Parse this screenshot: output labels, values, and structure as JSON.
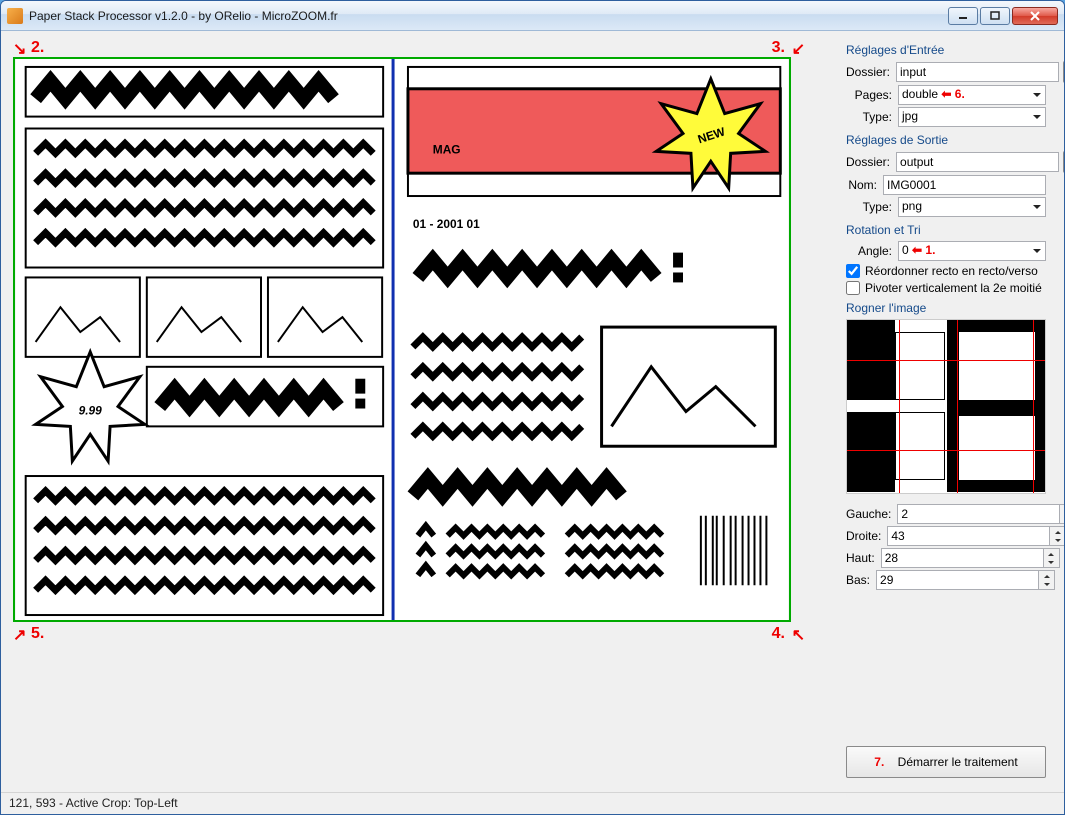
{
  "window": {
    "title": "Paper Stack Processor v1.2.0 - by ORelio - MicroZOOM.fr"
  },
  "annotations": {
    "n2": "2.",
    "n3": "3.",
    "n4": "4.",
    "n5": "5.",
    "n6": "6.",
    "n1": "1.",
    "n7": "7."
  },
  "input_settings": {
    "title": "Réglages d'Entrée",
    "folder_label": "Dossier:",
    "folder_value": "input",
    "browse": "...",
    "pages_label": "Pages:",
    "pages_value": "double",
    "type_label": "Type:",
    "type_value": "jpg"
  },
  "output_settings": {
    "title": "Réglages de Sortie",
    "folder_label": "Dossier:",
    "folder_value": "output",
    "browse": "...",
    "name_label": "Nom:",
    "name_value": "IMG0001",
    "type_label": "Type:",
    "type_value": "png"
  },
  "rotation_sort": {
    "title": "Rotation et Tri",
    "angle_label": "Angle:",
    "angle_value": "0",
    "reorder_label": "Réordonner recto en recto/verso",
    "reorder_checked": true,
    "flip_label": "Pivoter verticalement la 2e moitié",
    "flip_checked": false
  },
  "crop": {
    "title": "Rogner l'image",
    "left_label": "Gauche:",
    "left_value": "2",
    "right_label": "Droite:",
    "right_value": "43",
    "top_label": "Haut:",
    "top_value": "28",
    "bottom_label": "Bas:",
    "bottom_value": "29"
  },
  "start_button": "Démarrer le traitement",
  "status_bar": "121, 593 - Active Crop: Top-Left",
  "preview": {
    "mag": "MAG",
    "new": "NEW",
    "date": "01 - 2001 01",
    "price": "9.99"
  }
}
